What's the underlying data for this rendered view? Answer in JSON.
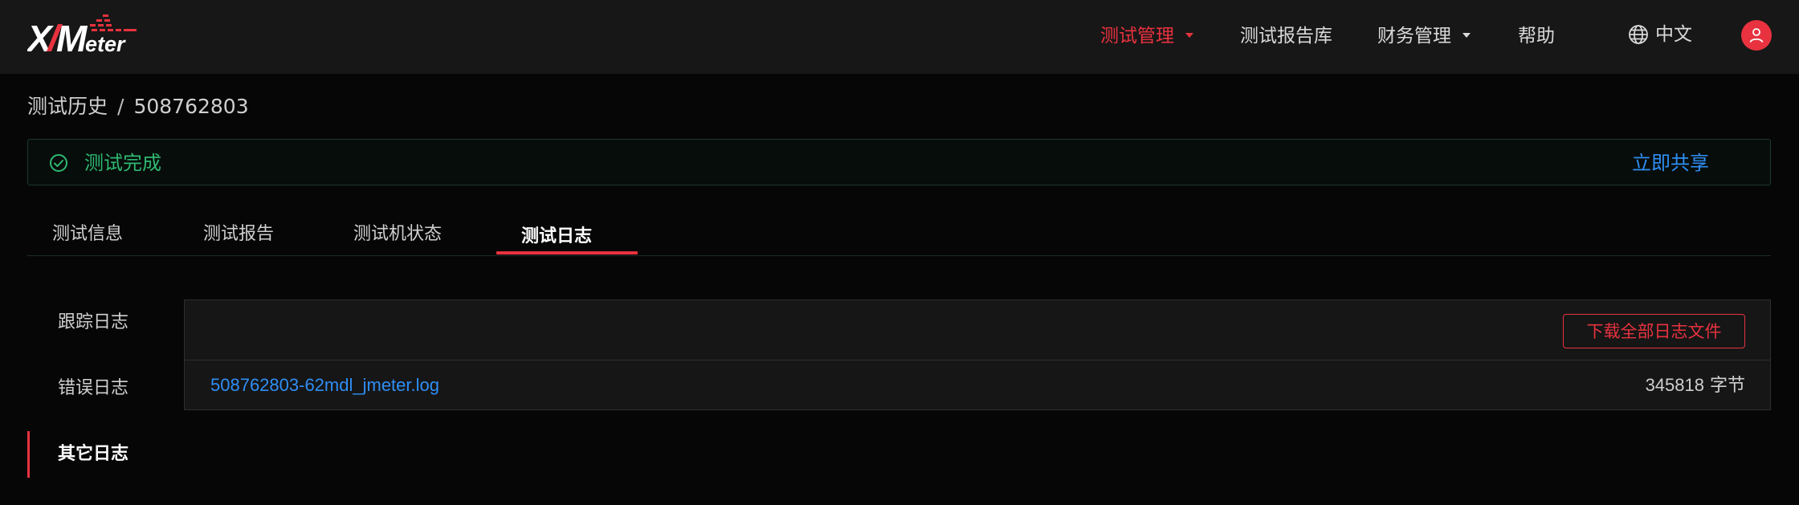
{
  "app": {
    "logo_text": "XMeter",
    "brand_color": "#e8323f"
  },
  "nav": {
    "items": [
      {
        "label": "测试管理",
        "active": true,
        "has_dropdown": true
      },
      {
        "label": "测试报告库",
        "active": false,
        "has_dropdown": false
      },
      {
        "label": "财务管理",
        "active": false,
        "has_dropdown": true
      },
      {
        "label": "帮助",
        "active": false,
        "has_dropdown": false
      }
    ],
    "language": {
      "icon": "globe-icon",
      "label": "中文"
    },
    "user": {
      "icon": "user-icon"
    }
  },
  "breadcrumb": {
    "parent": "测试历史",
    "separator": "/",
    "current": "508762803"
  },
  "status": {
    "icon": "check-circle-icon",
    "text": "测试完成",
    "color": "#2eb872",
    "share_label": "立即共享",
    "link_color": "#2f8ef4"
  },
  "tabs": [
    {
      "label": "测试信息",
      "active": false
    },
    {
      "label": "测试报告",
      "active": false
    },
    {
      "label": "测试机状态",
      "active": false
    },
    {
      "label": "测试日志",
      "active": true
    }
  ],
  "log_types": [
    {
      "label": "跟踪日志",
      "active": false
    },
    {
      "label": "错误日志",
      "active": false
    },
    {
      "label": "其它日志",
      "active": true
    }
  ],
  "log_panel": {
    "download_all_label": "下载全部日志文件",
    "files": [
      {
        "name": "508762803-62mdl_jmeter.log",
        "size": "345818",
        "size_unit": "字节"
      }
    ]
  }
}
